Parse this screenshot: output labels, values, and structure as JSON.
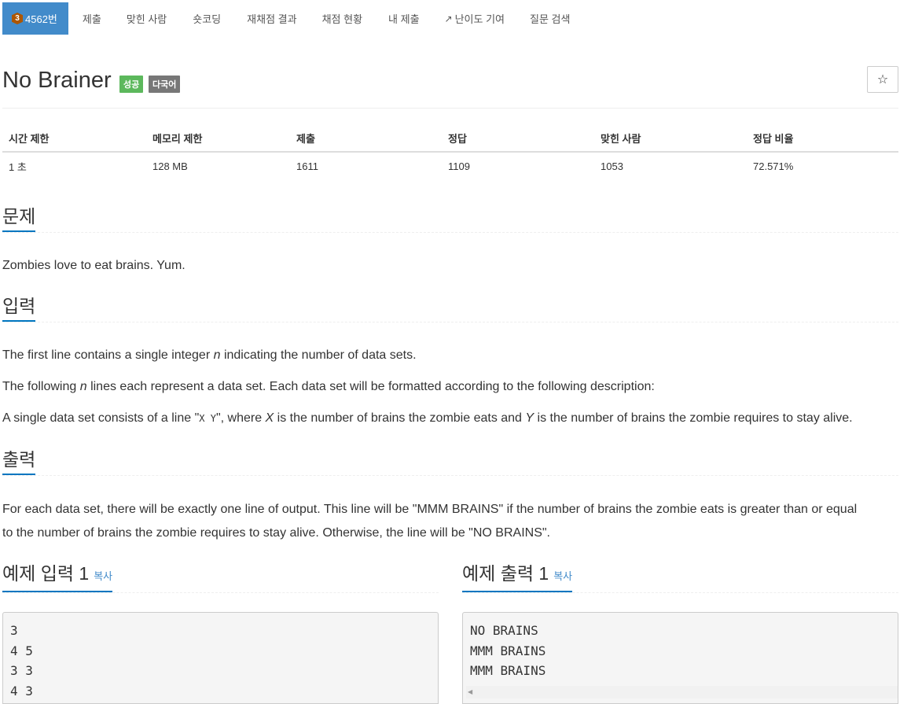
{
  "nav": {
    "problem_label": "4562번",
    "tier": "3",
    "items": [
      "제출",
      "맞힌 사람",
      "숏코딩",
      "재채점 결과",
      "채점 현황",
      "내 제출",
      "난이도 기여",
      "질문 검색"
    ]
  },
  "problem": {
    "title": "No Brainer",
    "labels": {
      "success": "성공",
      "multilang": "다국어"
    },
    "star": "☆"
  },
  "info": {
    "headers": [
      "시간 제한",
      "메모리 제한",
      "제출",
      "정답",
      "맞힌 사람",
      "정답 비율"
    ],
    "values": [
      "1 초",
      "128 MB",
      "1611",
      "1109",
      "1053",
      "72.571%"
    ]
  },
  "sections": {
    "description_title": "문제",
    "description": "Zombies love to eat brains. Yum.",
    "input_title": "입력",
    "input_line1_a": "The first line contains a single integer ",
    "input_line1_var": "n",
    "input_line1_b": " indicating the number of data sets.",
    "input_line2_a": "The following ",
    "input_line2_var": "n",
    "input_line2_b": " lines each represent a data set. Each data set will be formatted according to the following description:",
    "input_line3_a": "A single data set consists of a line \"",
    "input_line3_code": "X Y",
    "input_line3_b": "\", where ",
    "input_line3_x": "X",
    "input_line3_c": " is the number of brains the zombie eats and ",
    "input_line3_y": "Y",
    "input_line3_d": " is the number of brains the zombie requires to stay alive.",
    "output_title": "출력",
    "output_line1": "For each data set, there will be exactly one line of output. This line will be \"MMM BRAINS\" if the number of brains the zombie eats is greater than or equal",
    "output_line2": "to the number of brains the zombie requires to stay alive. Otherwise, the line will be \"NO BRAINS\"."
  },
  "samples": {
    "input_title": "예제 입력 1",
    "output_title": "예제 출력 1",
    "copy": "복사",
    "input": "3\n4 5\n3 3\n4 3",
    "output": "NO BRAINS\nMMM BRAINS\nMMM BRAINS"
  }
}
